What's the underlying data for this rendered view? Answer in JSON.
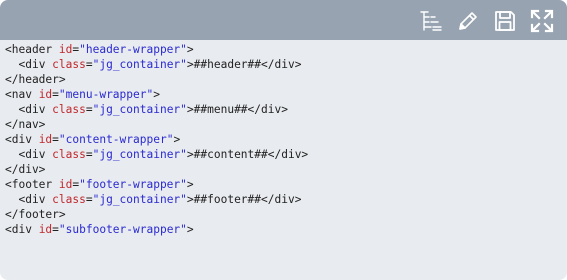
{
  "toolbar": {
    "icons": [
      "tree-view-icon",
      "edit-icon",
      "save-icon",
      "expand-icon"
    ],
    "background": "#97a3b0",
    "icon_color": "#ffffff"
  },
  "code": {
    "lines": [
      {
        "indent": "",
        "open": "<header",
        "attr": "id",
        "value": "\"header-wrapper\"",
        "close": ">",
        "text": "",
        "end": ""
      },
      {
        "indent": "  ",
        "open": "<div",
        "attr": "class",
        "value": "\"jg_container\"",
        "close": ">",
        "text": "##header##",
        "end": "</div>"
      },
      {
        "indent": "",
        "open": "</header>",
        "attr": "",
        "value": "",
        "close": "",
        "text": "",
        "end": ""
      },
      {
        "indent": "",
        "open": "<nav",
        "attr": "id",
        "value": "\"menu-wrapper\"",
        "close": ">",
        "text": "",
        "end": ""
      },
      {
        "indent": "  ",
        "open": "<div",
        "attr": "class",
        "value": "\"jg_container\"",
        "close": ">",
        "text": "##menu##",
        "end": "</div>"
      },
      {
        "indent": "",
        "open": "</nav>",
        "attr": "",
        "value": "",
        "close": "",
        "text": "",
        "end": ""
      },
      {
        "indent": "",
        "open": "<div",
        "attr": "id",
        "value": "\"content-wrapper\"",
        "close": ">",
        "text": "",
        "end": ""
      },
      {
        "indent": "  ",
        "open": "<div",
        "attr": "class",
        "value": "\"jg_container\"",
        "close": ">",
        "text": "##content##",
        "end": "</div>"
      },
      {
        "indent": "",
        "open": "</div>",
        "attr": "",
        "value": "",
        "close": "",
        "text": "",
        "end": ""
      },
      {
        "indent": "",
        "open": "<footer",
        "attr": "id",
        "value": "\"footer-wrapper\"",
        "close": ">",
        "text": "",
        "end": ""
      },
      {
        "indent": "  ",
        "open": "<div",
        "attr": "class",
        "value": "\"jg_container\"",
        "close": ">",
        "text": "##footer##",
        "end": "</div>"
      },
      {
        "indent": "",
        "open": "</footer>",
        "attr": "",
        "value": "",
        "close": "",
        "text": "",
        "end": ""
      },
      {
        "indent": "",
        "open": "<div",
        "attr": "id",
        "value": "\"subfooter-wrapper\"",
        "close": ">",
        "text": "",
        "end": ""
      }
    ],
    "colors": {
      "tag": "#222222",
      "attribute": "#c0282d",
      "value": "#2a2ad0",
      "background": "#e8ebef"
    }
  }
}
